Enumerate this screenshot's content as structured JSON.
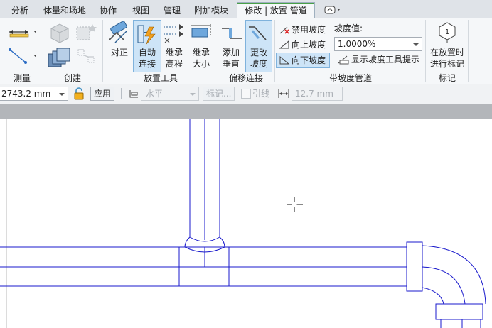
{
  "tabs": [
    {
      "label": "分析",
      "active": false
    },
    {
      "label": "体量和场地",
      "active": false
    },
    {
      "label": "协作",
      "active": false
    },
    {
      "label": "视图",
      "active": false
    },
    {
      "label": "管理",
      "active": false
    },
    {
      "label": "附加模块",
      "active": false
    },
    {
      "label": "修改 | 放置 管道",
      "active": true
    }
  ],
  "panels": {
    "measure": {
      "label": "测量"
    },
    "create": {
      "label": "创建"
    },
    "placement_tools": {
      "label": "放置工具",
      "justify": "对正",
      "auto_connect_1": "自动",
      "auto_connect_2": "连接",
      "inherit_elev_1": "继承",
      "inherit_elev_2": "高程",
      "inherit_size_1": "继承",
      "inherit_size_2": "大小"
    },
    "offset_connect": {
      "label": "偏移连接",
      "add_vertical_1": "添加",
      "add_vertical_2": "垂直",
      "change_slope_1": "更改",
      "change_slope_2": "坡度"
    },
    "sloped_pipe": {
      "label": "带坡度管道",
      "disable_slope": "禁用坡度",
      "slope_up": "向上坡度",
      "slope_down": "向下坡度",
      "slope_value_label": "坡度值:",
      "slope_value": "1.0000%",
      "show_slope_tooltip": "显示坡度工具提示"
    },
    "tag": {
      "label": "标记",
      "tag_on_place_1": "在放置时",
      "tag_on_place_2": "进行标记"
    }
  },
  "options_bar": {
    "offset_value": "2743.2 mm",
    "apply_label": "应用",
    "orientation": "水平",
    "tag_label": "标记...",
    "leader_label": "引线",
    "leader_length": "12.7 mm"
  },
  "colors": {
    "pipe_stroke": "#1a1acc",
    "active_tab_accent": "#49a048",
    "active_button_bg": "#cde4f7"
  }
}
